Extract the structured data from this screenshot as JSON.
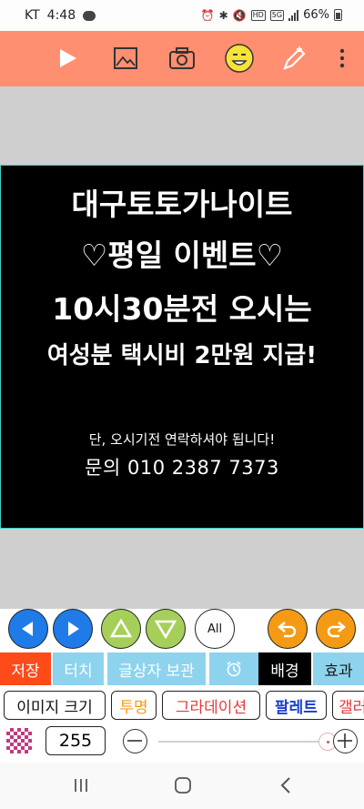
{
  "status_bar": {
    "carrier": "KT",
    "time": "4:48",
    "network_tag": "5G",
    "battery": "66%"
  },
  "toolbar": {
    "icons": [
      "play-icon",
      "image-icon",
      "camera-icon",
      "emoji-icon",
      "edit-icon",
      "more-icon"
    ]
  },
  "canvas": {
    "lines": [
      "대구토토가나이트",
      "♡평일 이벤트♡",
      "10시30분전 오시는",
      "여성분 택시비 2만원 지급!",
      "단, 오시기전 연락하셔야 됩니다!",
      "문의 010 2387 7373"
    ]
  },
  "nav_buttons": {
    "all_label": "All"
  },
  "tabs": [
    {
      "label": "저장",
      "bg": "#ff4a1a",
      "fg": "#ffffff"
    },
    {
      "label": "터치",
      "bg": "#8ed3ee",
      "fg": "#ffffff"
    },
    {
      "label": "글상자 보관",
      "bg": "#8ed3ee",
      "fg": "#ffffff"
    },
    {
      "label": "",
      "bg": "#8ed3ee",
      "fg": "#ffffff"
    },
    {
      "label": "배경",
      "bg": "#000000",
      "fg": "#ffffff"
    },
    {
      "label": "효과",
      "bg": "#8ed3ee",
      "fg": "#1a1a1a"
    }
  ],
  "option_buttons": [
    {
      "label": "이미지 크기",
      "color": "#111111"
    },
    {
      "label": "투명",
      "color": "#f59a14"
    },
    {
      "label": "그라데이션",
      "color": "#e8383d"
    },
    {
      "label": "팔레트",
      "color": "#1a3ccf"
    },
    {
      "label": "갤러",
      "color": "#e8383d"
    }
  ],
  "slider": {
    "alpha_value": "255",
    "level": 1.0
  },
  "colors": {
    "toolbar": "#ff8f70",
    "canvas_border": "#3bd4c6",
    "blue": "#1e7be8",
    "green": "#a6cf5a",
    "orange": "#f59a14"
  }
}
